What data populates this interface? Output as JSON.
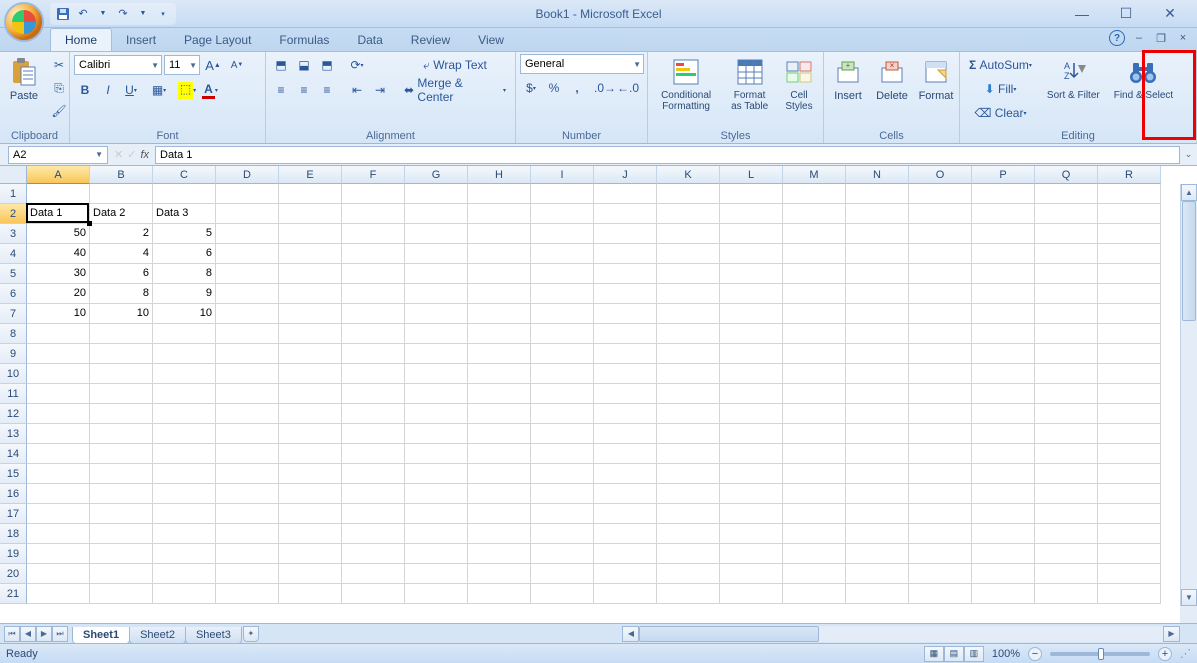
{
  "title": "Book1 - Microsoft Excel",
  "qat": {
    "save": "save-icon",
    "undo": "undo-icon",
    "redo": "redo-icon"
  },
  "tabs": [
    "Home",
    "Insert",
    "Page Layout",
    "Formulas",
    "Data",
    "Review",
    "View"
  ],
  "active_tab": "Home",
  "ribbon": {
    "clipboard": {
      "label": "Clipboard",
      "paste": "Paste"
    },
    "font": {
      "label": "Font",
      "name": "Calibri",
      "size": "11"
    },
    "alignment": {
      "label": "Alignment",
      "wrap": "Wrap Text",
      "merge": "Merge & Center"
    },
    "number": {
      "label": "Number",
      "format": "General"
    },
    "styles": {
      "label": "Styles",
      "cond": "Conditional Formatting",
      "table": "Format as Table",
      "cell": "Cell Styles"
    },
    "cells": {
      "label": "Cells",
      "insert": "Insert",
      "delete": "Delete",
      "format": "Format"
    },
    "editing": {
      "label": "Editing",
      "autosum": "AutoSum",
      "fill": "Fill",
      "clear": "Clear",
      "sort": "Sort & Filter",
      "find": "Find & Select"
    }
  },
  "name_box": "A2",
  "formula_value": "Data 1",
  "columns": [
    "A",
    "B",
    "C",
    "D",
    "E",
    "F",
    "G",
    "H",
    "I",
    "J",
    "K",
    "L",
    "M",
    "N",
    "O",
    "P",
    "Q",
    "R"
  ],
  "row_count": 21,
  "active_cell": {
    "col": 0,
    "row": 1
  },
  "cells_data": {
    "r2": {
      "A": "Data 1",
      "B": "Data 2",
      "C": "Data 3"
    },
    "r3": {
      "A": "50",
      "B": "2",
      "C": "5"
    },
    "r4": {
      "A": "40",
      "B": "4",
      "C": "6"
    },
    "r5": {
      "A": "30",
      "B": "6",
      "C": "8"
    },
    "r6": {
      "A": "20",
      "B": "8",
      "C": "9"
    },
    "r7": {
      "A": "10",
      "B": "10",
      "C": "10"
    }
  },
  "sheets": [
    "Sheet1",
    "Sheet2",
    "Sheet3"
  ],
  "active_sheet": "Sheet1",
  "status_text": "Ready",
  "zoom": "100%"
}
